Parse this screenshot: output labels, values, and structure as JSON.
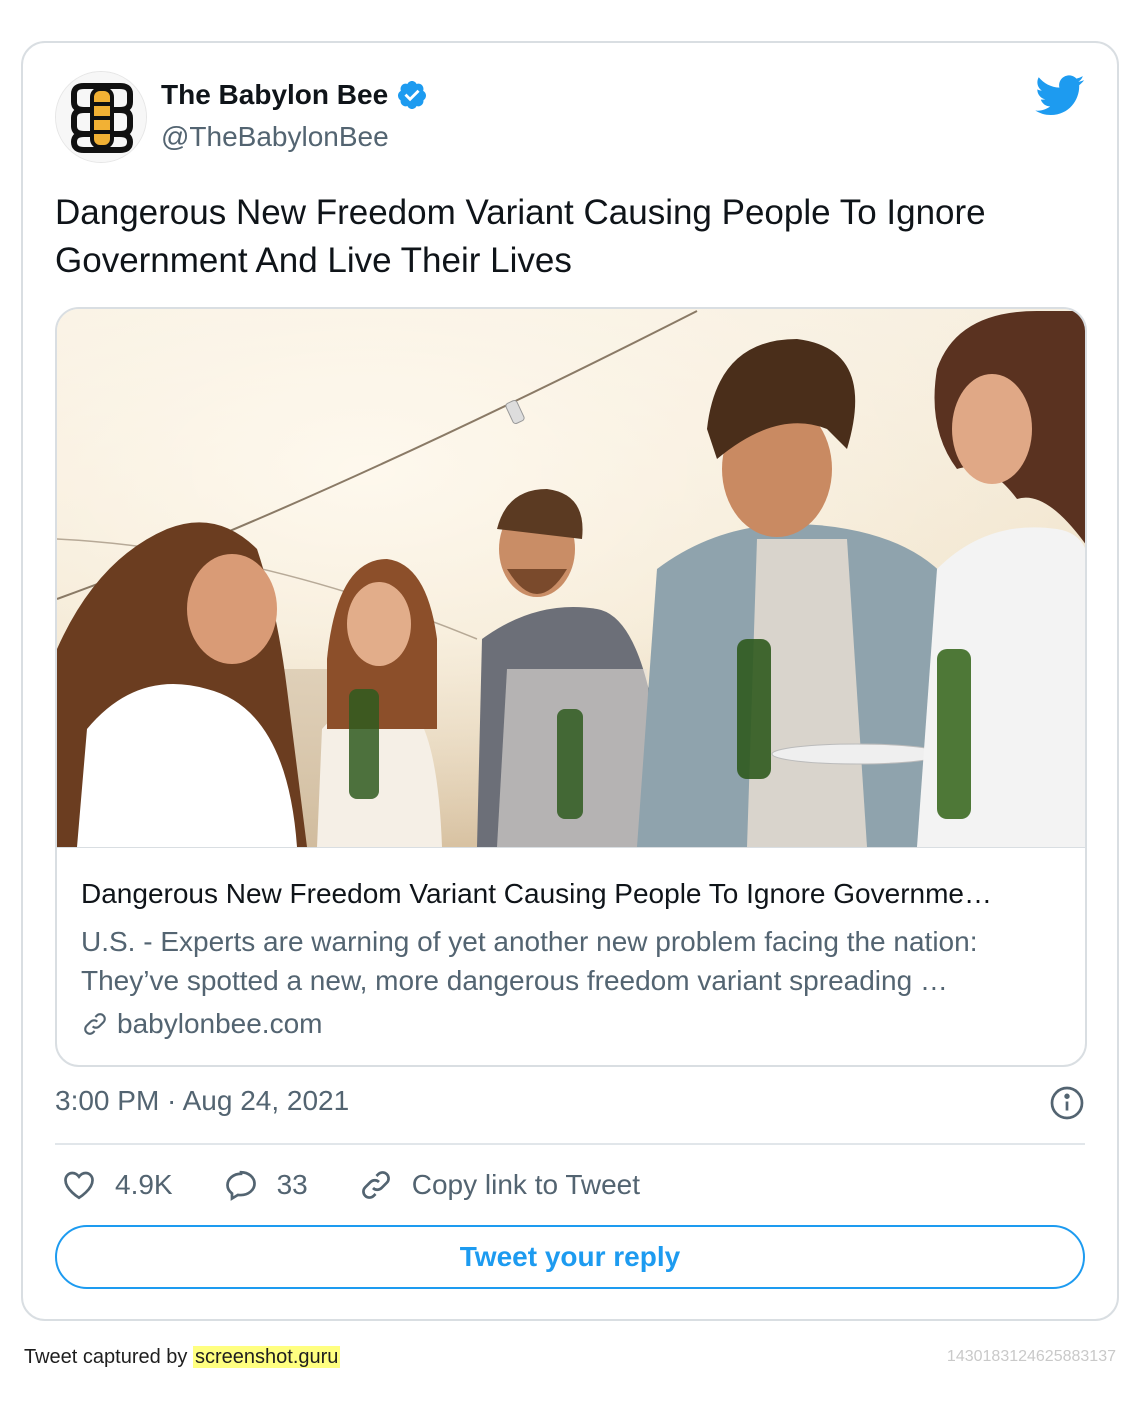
{
  "tweet": {
    "author_name": "The Babylon Bee",
    "author_handle": "@TheBabylonBee",
    "text": "Dangerous New Freedom Variant Causing People To Ignore Government And Live Their Lives",
    "timestamp": "3:00 PM · Aug 24, 2021"
  },
  "link_card": {
    "title": "Dangerous New Freedom Variant Causing People To Ignore Governme…",
    "description": "U.S. - Experts are warning of yet another new problem facing the nation: They’ve spotted a new, more dangerous freedom variant spreading …",
    "domain": "babylonbee.com"
  },
  "actions": {
    "likes": "4.9K",
    "replies": "33",
    "copy_link": "Copy link to Tweet"
  },
  "reply_button": "Tweet your reply",
  "footer": {
    "captured_prefix": "Tweet captured by",
    "captured_link": "screenshot.guru",
    "tweet_id": "1430183124625883137"
  },
  "colors": {
    "accent": "#1d9bf0",
    "secondary_text": "#536471",
    "border": "#d9dee2",
    "highlight": "#ffff80"
  },
  "icons": [
    "babylon-bee-logo-icon",
    "verified-badge-icon",
    "twitter-bird-icon",
    "link-icon",
    "info-icon",
    "heart-icon",
    "reply-bubble-icon",
    "copy-link-icon"
  ]
}
